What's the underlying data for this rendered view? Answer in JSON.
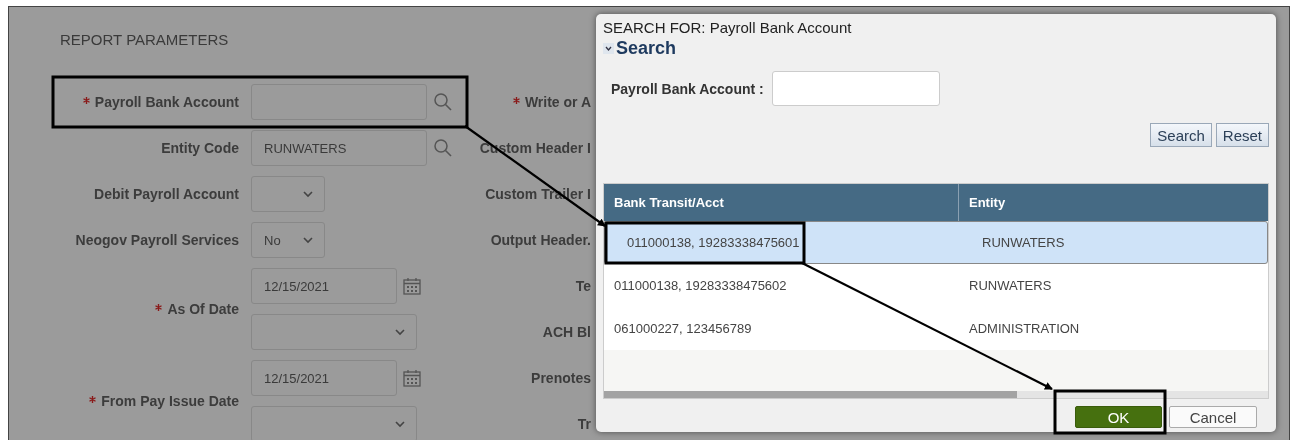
{
  "form": {
    "title": "REPORT PARAMETERS",
    "fields": [
      {
        "label": "Payroll Bank Account",
        "required": true,
        "kind": "lookup"
      },
      {
        "label": "Entity Code",
        "required": false,
        "kind": "lookup",
        "value": "RUNWATERS"
      },
      {
        "label": "Debit Payroll Account",
        "required": false,
        "kind": "select"
      },
      {
        "label": "Neogov Payroll Services",
        "required": false,
        "kind": "select",
        "value": "No"
      },
      {
        "label": "As Of Date",
        "required": true,
        "kind": "date",
        "value": "12/15/2021"
      },
      {
        "label": "From Pay Issue Date",
        "required": true,
        "kind": "date",
        "value": "12/15/2021"
      }
    ],
    "right_labels": [
      {
        "label": "Write or A",
        "required": true
      },
      {
        "label": "Custom Header I",
        "required": false
      },
      {
        "label": "Custom Trailer I",
        "required": false
      },
      {
        "label": "Output Header.",
        "required": false
      },
      {
        "label": "Te",
        "required": false
      },
      {
        "label": "ACH Bl",
        "required": false
      },
      {
        "label": "Prenotes",
        "required": false
      },
      {
        "label": "Tr",
        "required": false
      }
    ]
  },
  "dialog": {
    "title": "SEARCH FOR: Payroll Bank Account",
    "section": {
      "label": "Search",
      "expanded": true
    },
    "filter": {
      "label": "Payroll Bank Account :"
    },
    "filter_buttons": [
      "Search",
      "Reset"
    ],
    "table": {
      "columns": [
        "Bank Transit/Acct",
        "Entity"
      ],
      "rows": [
        {
          "cells": [
            "011000138, 19283338475601",
            "RUNWATERS"
          ],
          "selected": true
        },
        {
          "cells": [
            "011000138, 19283338475602",
            "RUNWATERS"
          ],
          "selected": false
        },
        {
          "cells": [
            "061000227, 123456789",
            "ADMINISTRATION"
          ],
          "selected": false
        }
      ]
    },
    "footer_buttons": [
      {
        "label": "OK",
        "kind": "primary"
      },
      {
        "label": "Cancel",
        "kind": "secondary"
      }
    ]
  }
}
